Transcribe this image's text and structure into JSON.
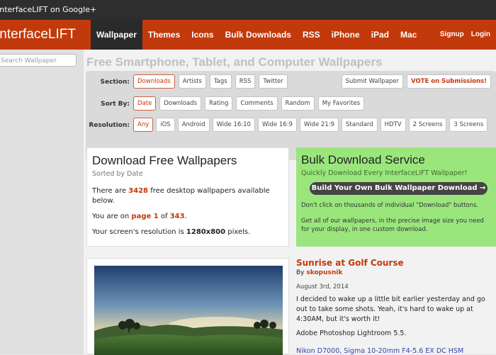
{
  "gplus_bar": {
    "text": "InterfaceLIFT on Google+"
  },
  "header": {
    "logo": "InterfaceLIFT",
    "nav": [
      {
        "label": "Wallpaper",
        "active": true
      },
      {
        "label": "Themes"
      },
      {
        "label": "Icons"
      },
      {
        "label": "Bulk Downloads"
      },
      {
        "label": "RSS"
      },
      {
        "label": "iPhone"
      },
      {
        "label": "iPad"
      },
      {
        "label": "Mac"
      }
    ],
    "signup": "Signup",
    "login": "Login"
  },
  "sidebar": {
    "search_placeholder": "Search Wallpaper"
  },
  "main": {
    "title": "Free Smartphone, Tablet, and Computer Wallpapers",
    "filters": {
      "section": {
        "label": "Section:",
        "options": [
          "Downloads",
          "Artists",
          "Tags",
          "RSS",
          "Twitter"
        ],
        "selected": "Downloads"
      },
      "submit": "Submit Wallpaper",
      "vote": "VOTE on Submissions!",
      "sort": {
        "label": "Sort By:",
        "options": [
          "Date",
          "Downloads",
          "Rating",
          "Comments",
          "Random",
          "My Favorites"
        ],
        "selected": "Date"
      },
      "resolution": {
        "label": "Resolution:",
        "options": [
          "Any",
          "iOS",
          "Android",
          "Wide 16:10",
          "Wide 16:9",
          "Wide 21:9",
          "Standard",
          "HDTV",
          "2 Screens",
          "3 Screens"
        ],
        "selected": "Any"
      }
    },
    "download_box": {
      "title": "Download Free Wallpapers",
      "subtitle": "Sorted by Date",
      "count_pre": "There are ",
      "count": "3428",
      "count_post": " free desktop wallpapers available below.",
      "page_pre": "You are on ",
      "page_link": "page 1",
      "page_mid": " of ",
      "page_total": "343",
      "page_post": ".",
      "res_pre": "Your screen's resolution is ",
      "res": "1280x800",
      "res_post": " pixels."
    },
    "bulk_box": {
      "title": "Bulk Download Service",
      "subtitle": "Quickly Download Every InterfaceLIFT Wallpaper!",
      "button": "Build Your Own Bulk Wallpaper Download →",
      "line1": "Don't click on thousands of individual \"Download\" buttons.",
      "line2": "Get all of our wallpapers, in the precise image size you need for your display, in one custom download."
    },
    "post": {
      "title": "Sunrise at Golf Course",
      "by_label": "By ",
      "author": "skopusnik",
      "date": "August 3rd, 2014",
      "body": "I decided to wake up a little bit earlier yesterday and go out to take some shots. Yeah, it's hard to wake up at 4:30AM, but it's worth it!",
      "software": "Adobe Photoshop Lightroom 5.5.",
      "gear": "Nikon D7000, Sigma 10-20mm F4-5.6 EX DC HSM"
    }
  }
}
